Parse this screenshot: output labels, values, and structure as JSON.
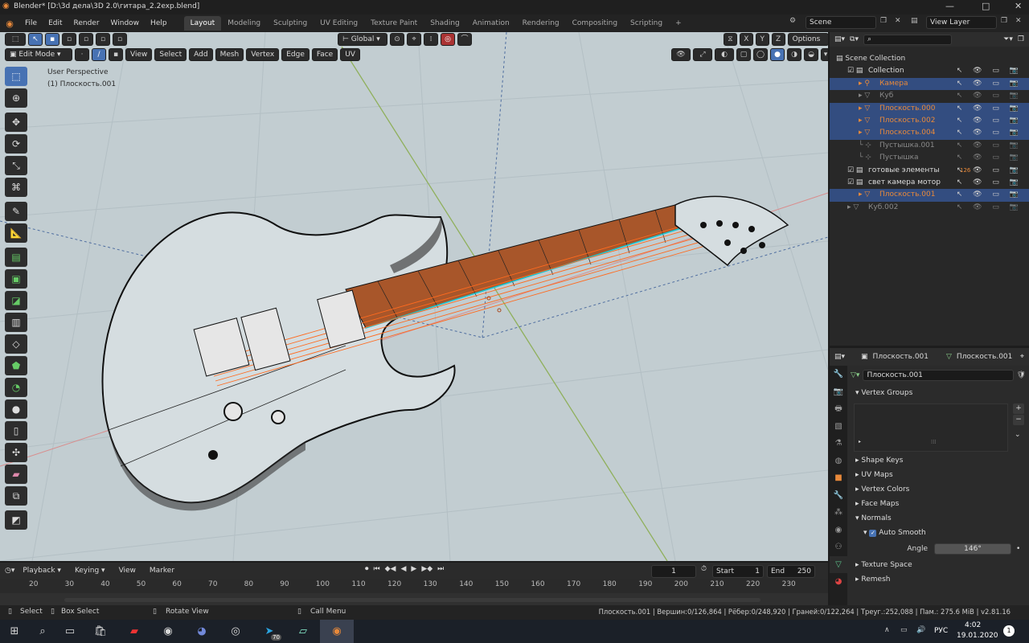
{
  "window": {
    "title": "Blender* [D:\\3d дела\\3D 2.0\\гитара_2.2exp.blend]",
    "controls": [
      "—",
      "□",
      "✕"
    ]
  },
  "menu": [
    "File",
    "Edit",
    "Render",
    "Window",
    "Help"
  ],
  "workspaces": [
    "Layout",
    "Modeling",
    "Sculpting",
    "UV Editing",
    "Texture Paint",
    "Shading",
    "Animation",
    "Rendering",
    "Compositing",
    "Scripting"
  ],
  "active_workspace": "Layout",
  "scene": {
    "label": "Scene",
    "view_layer": "View Layer"
  },
  "header": {
    "orientation": "Global",
    "options": "Options"
  },
  "edit_header": {
    "mode": "Edit Mode",
    "menus": [
      "View",
      "Select",
      "Add",
      "Mesh",
      "Vertex",
      "Edge",
      "Face",
      "UV"
    ]
  },
  "viewport": {
    "perspective": "User Perspective",
    "object": "(1) Плоскость.001",
    "gizmo_axes": [
      "X",
      "Y",
      "Z"
    ]
  },
  "tools": [
    "select-box",
    "cursor",
    "move",
    "rotate",
    "scale",
    "transform",
    "annotate",
    "measure",
    "extrude",
    "inset",
    "bevel",
    "loop-cut",
    "knife",
    "poly-build",
    "spin",
    "smooth",
    "edge-slide",
    "shrink-fatten",
    "shear",
    "rip"
  ],
  "outliner": {
    "search_placeholder": "",
    "root": "Scene Collection",
    "rows": [
      {
        "name": "Collection",
        "level": 1,
        "type": "collection",
        "selected": false,
        "dim": false
      },
      {
        "name": "Камера",
        "level": 2,
        "type": "camera",
        "selected": true,
        "dim": false,
        "color": "#e8893a"
      },
      {
        "name": "Куб",
        "level": 2,
        "type": "mesh",
        "selected": false,
        "dim": true,
        "color": "#e8893a"
      },
      {
        "name": "Плоскость.000",
        "level": 2,
        "type": "mesh",
        "selected": true,
        "dim": false,
        "color": "#e8893a"
      },
      {
        "name": "Плоскость.002",
        "level": 2,
        "type": "mesh",
        "selected": true,
        "dim": false,
        "color": "#e8893a"
      },
      {
        "name": "Плоскость.004",
        "level": 2,
        "type": "mesh",
        "selected": true,
        "dim": false,
        "color": "#e8893a"
      },
      {
        "name": "Пустышка.001",
        "level": 2,
        "type": "empty",
        "selected": false,
        "dim": true,
        "color": "#888888"
      },
      {
        "name": "Пустышка",
        "level": 2,
        "type": "empty",
        "selected": false,
        "dim": true,
        "color": "#888888"
      },
      {
        "name": "готовые элементы",
        "level": 1,
        "type": "collection",
        "selected": false,
        "dim": false,
        "badge": "126"
      },
      {
        "name": "свет камера мотор",
        "level": 1,
        "type": "collection",
        "selected": false,
        "dim": false
      },
      {
        "name": "Плоскость.001",
        "level": 2,
        "type": "mesh",
        "selected": true,
        "dim": false,
        "color": "#e8893a"
      },
      {
        "name": "Куб.002",
        "level": 1,
        "type": "mesh",
        "selected": false,
        "dim": true,
        "color": "#888888"
      }
    ]
  },
  "properties": {
    "breadcrumb_object": "Плоскость.001",
    "breadcrumb_data": "Плоскость.001",
    "data_name": "Плоскость.001",
    "vertex_groups": "Vertex Groups",
    "panels": [
      "Shape Keys",
      "UV Maps",
      "Vertex Colors",
      "Face Maps"
    ],
    "normals": "Normals",
    "auto_smooth": "Auto Smooth",
    "angle_label": "Angle",
    "angle_value": "146°",
    "panels_after": [
      "Texture Space",
      "Remesh"
    ]
  },
  "timeline": {
    "menus": [
      "Playback",
      "Keying",
      "View",
      "Marker"
    ],
    "current_frame": "1",
    "start_label": "Start",
    "start": "1",
    "end_label": "End",
    "end": "250",
    "ruler": [
      "20",
      "30",
      "40",
      "50",
      "60",
      "70",
      "80",
      "90",
      "100",
      "110",
      "120",
      "130",
      "140",
      "150",
      "160",
      "170",
      "180",
      "190",
      "200",
      "210",
      "220",
      "230"
    ]
  },
  "statusbar": {
    "select": "Select",
    "box_select": "Box Select",
    "rotate_view": "Rotate View",
    "call_menu": "Call Menu",
    "stats": "Плоскость.001 | Вершин:0/126,864 | Рёбер:0/248,920 | Граней:0/122,264 | Треуг.:252,088 | Пам.: 275.6 MiB | v2.81.16"
  },
  "taskbar": {
    "apps": [
      "store",
      "acrobat",
      "chrome",
      "discord",
      "steam",
      "telegram",
      "notes",
      "blender"
    ],
    "telegram_badge": "70",
    "lang": "РУС",
    "time": "4:02",
    "date": "19.01.2020",
    "notification_count": "1"
  }
}
